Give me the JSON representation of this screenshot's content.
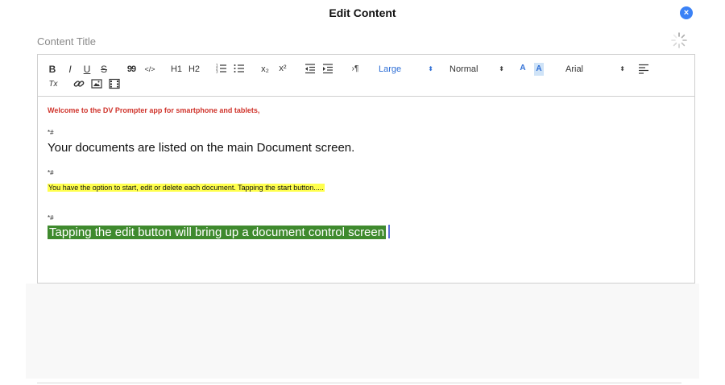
{
  "header": {
    "title": "Edit Content",
    "close_icon": "close-icon",
    "close_symbol": "×"
  },
  "title_field": {
    "placeholder": "Content Title",
    "value": ""
  },
  "toolbar": {
    "bold": "B",
    "italic": "I",
    "underline": "U",
    "strike": "S",
    "blockquote": "99",
    "code": "</>",
    "h1": "H1",
    "h2": "H2",
    "superscript_label": "x²",
    "subscript_label": "x₂",
    "direction": "›¶",
    "size_select": "Large",
    "header_select": "Normal",
    "font_color": "A",
    "font_bg": "A",
    "font_select": "Arial",
    "clean": "Tx",
    "accent_color": "#2f6fd6"
  },
  "content": {
    "line1": "Welcome to the DV Prompter app for smartphone and tablets,",
    "marker1": "*#",
    "line2": "Your documents are listed on the main Document screen.",
    "marker2": "*#",
    "line3": "You have the option to start, edit or delete each document. Tapping the start button.....",
    "marker3": "*#",
    "line4": "Tapping the edit button will bring up a document control screen"
  },
  "colors": {
    "red_text": "#d0342c",
    "yellow_highlight": "#ffff4d",
    "green_highlight": "#3f8a2e",
    "close_button": "#3b82f6"
  }
}
